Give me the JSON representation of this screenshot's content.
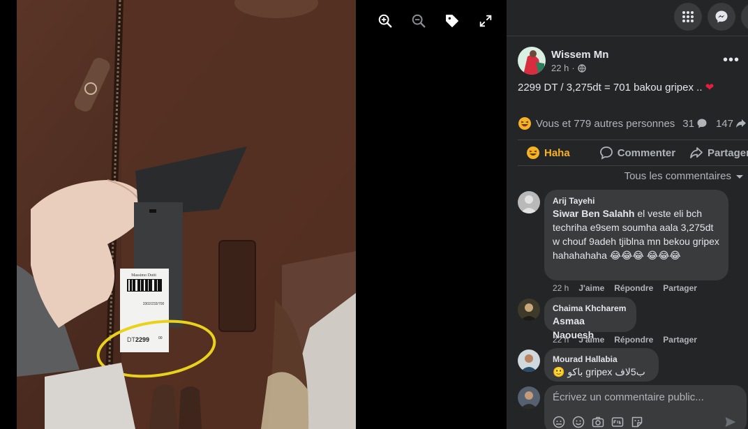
{
  "post": {
    "author": "Wissem Mn",
    "time": "22 h",
    "privacy_separator": "·",
    "text": "2299 DT / 3,275dt = 701 bakou gripex ..",
    "text_emoji": "❤"
  },
  "reactions": {
    "summary": "Vous et 779 autres personnes",
    "comments_count": "31",
    "shares_count": "147"
  },
  "actions": {
    "haha": "Haha",
    "comment": "Commenter",
    "share": "Partager"
  },
  "filter": "Tous les commentaires",
  "comments": [
    {
      "name": "Arij Tayehi",
      "mention": "Siwar Ben Salahh",
      "text": " el veste eli bch techriha e9sem soumha aala 3,275dt w chouf 9adeh tjiblna mn bekou gripex hahahahaha 😂😂😂 😂😂😂",
      "time": "22 h",
      "like": "J'aime",
      "reply": "Répondre",
      "share": "Partager"
    },
    {
      "name": "Chaima Khcharem",
      "mention": "Asmaa Naouesh",
      "text": "",
      "time": "22 h",
      "like": "J'aime",
      "reply": "Répondre",
      "share": "Partager"
    },
    {
      "name": "Mourad Hallabia",
      "mention": "",
      "text": "🙂 باكو gripex ب5لاف",
      "time": "",
      "like": "",
      "reply": "",
      "share": ""
    }
  ],
  "composer": {
    "placeholder": "Écrivez un commentaire public..."
  },
  "photo": {
    "tag_brand": "Massimo Dutti",
    "tag_ref": "3302/233/700",
    "tag_currency": "DT",
    "tag_price": "2299",
    "tag_cents": "00"
  },
  "icons": {
    "viewer": [
      "zoom-in-icon",
      "zoom-out-icon",
      "tag-icon",
      "fullscreen-icon"
    ],
    "topbar": [
      "menu-grid-icon",
      "messenger-icon"
    ]
  },
  "colors": {
    "panel_bg": "#242526",
    "bubble_bg": "#3a3b3c",
    "haha_accent": "#f7b125",
    "text_primary": "#e4e6eb",
    "text_secondary": "#b0b3b8"
  }
}
